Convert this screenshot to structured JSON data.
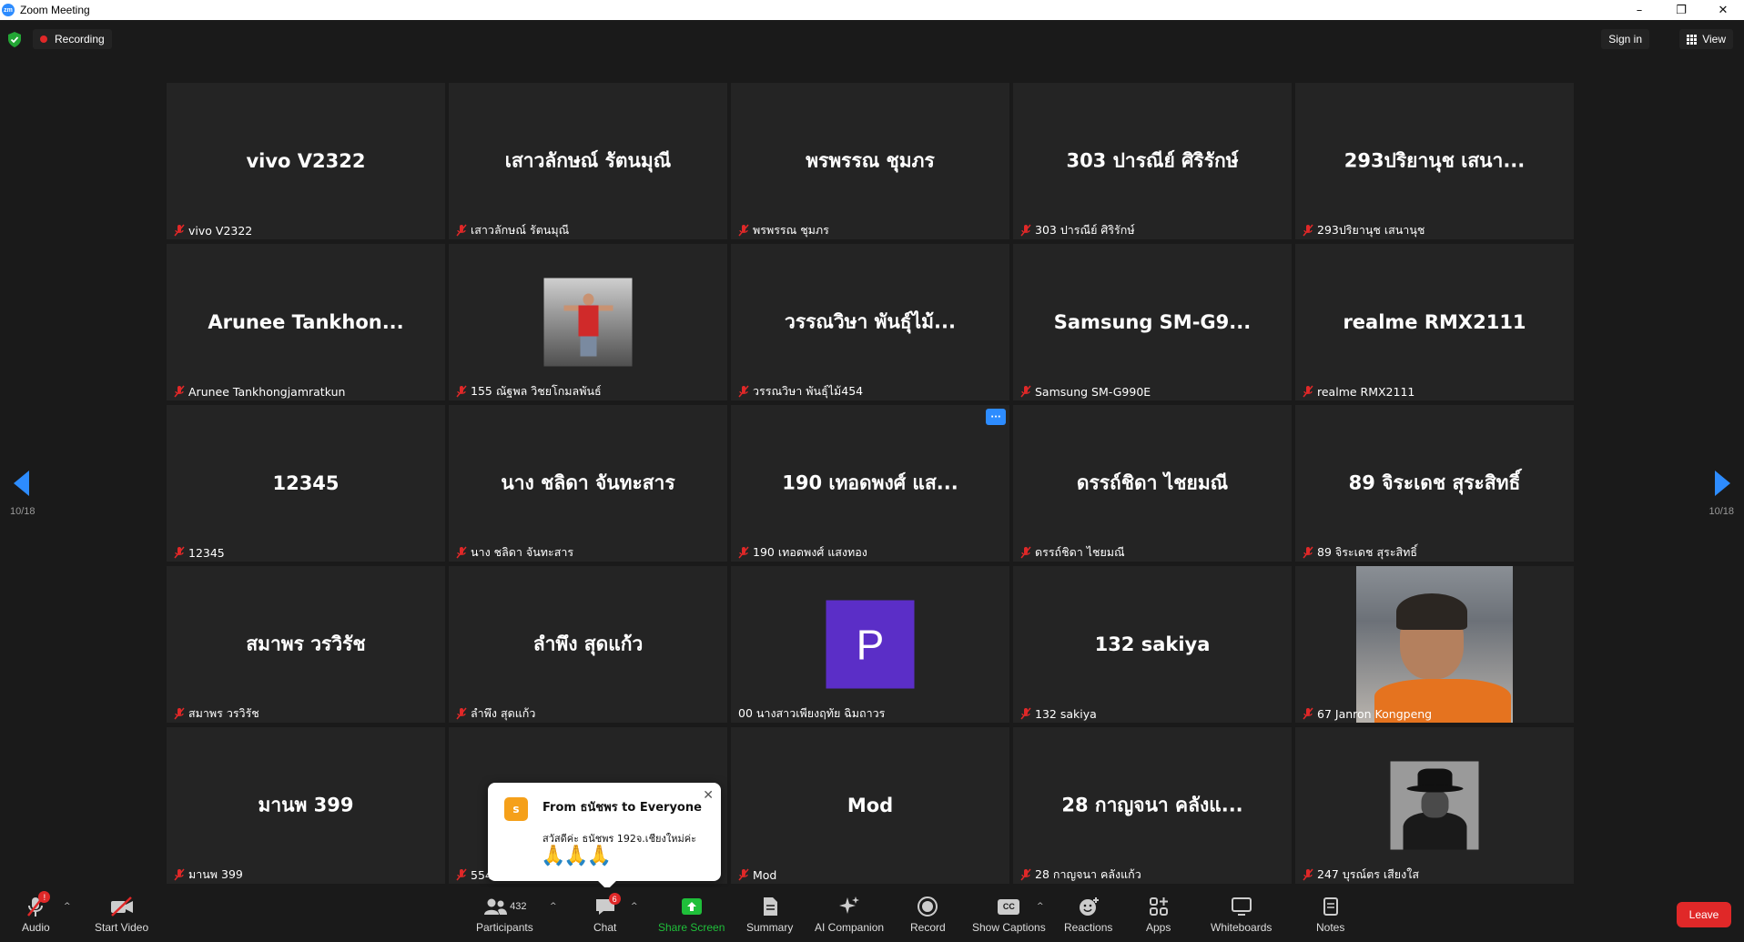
{
  "window": {
    "title": "Zoom Meeting",
    "logo_text": "zm",
    "minimize": "–",
    "restore": "❐",
    "close": "✕"
  },
  "topbar": {
    "recording_label": "Recording",
    "sign_in_label": "Sign in",
    "view_label": "View"
  },
  "pagination": {
    "left": "10/18",
    "right": "10/18"
  },
  "tiles": [
    {
      "big": "vivo V2322",
      "name": "vivo V2322"
    },
    {
      "big": "เสาวลักษณ์  รัตนมุณี",
      "name": "เสาวลักษณ์  รัตนมุณี"
    },
    {
      "big": "พรพรรณ ชุมภร",
      "name": "พรพรรณ ชุมภร"
    },
    {
      "big": "303 ปารณีย์ ศิริรักษ์",
      "name": "303 ปารณีย์ ศิริรักษ์"
    },
    {
      "big": "293ปริยานุช เสนา...",
      "name": "293ปริยานุช เสนานุช"
    },
    {
      "big": "Arunee  Tankhon...",
      "name": "Arunee Tankhongjamratkun"
    },
    {
      "big": "",
      "name": "155 ณัฐพล วิชยโกมลพันธ์"
    },
    {
      "big": "วรรณวิษา พันธุ์ไม้...",
      "name": "วรรณวิษา พันธุ์ไม้454"
    },
    {
      "big": "Samsung  SM-G9...",
      "name": "Samsung SM-G990E"
    },
    {
      "big": "realme RMX2111",
      "name": "realme RMX2111"
    },
    {
      "big": "12345",
      "name": "12345"
    },
    {
      "big": "นาง ชลิดา จันทะสาร",
      "name": "นาง ชลิดา จันทะสาร"
    },
    {
      "big": "190 เทอดพงศ์ แส...",
      "name": "190 เทอดพงศ์ แสงทอง",
      "more": "···"
    },
    {
      "big": "ดรรถ์ชิดา ไชยมณี",
      "name": "ดรรถ์ชิดา ไชยมณี"
    },
    {
      "big": "89 จิระเดช สุระสิทธิ์",
      "name": "89 จิระเดช สุระสิทธิ์"
    },
    {
      "big": "สมาพร  วรวิรัช",
      "name": "สมาพร  วรวิรัช"
    },
    {
      "big": "ลำพึง สุดแก้ว",
      "name": "ลำพึง สุดแก้ว"
    },
    {
      "big": "",
      "name": "00 นางสาวเพียงฤทัย ฉิมถาวร",
      "avatar_letter": "P"
    },
    {
      "big": "132 sakiya",
      "name": "132 sakiya"
    },
    {
      "big": "",
      "name": "67 Janron Kongpeng"
    },
    {
      "big": "มานพ 399",
      "name": "มานพ 399"
    },
    {
      "big": "",
      "name": "554"
    },
    {
      "big": "Mod",
      "name": "Mod"
    },
    {
      "big": "28 กาญจนา คลังแ...",
      "name": "28 กาญจนา คลังแก้ว"
    },
    {
      "big": "",
      "name": "247 บุรณ์ตร เสียงใส"
    }
  ],
  "chat_popup": {
    "avatar_letter": "s",
    "from": "From ธนัชพร to Everyone",
    "message": "สวัสดีค่ะ ธนัชพร 192จ.เชียงใหม่ค่ะ",
    "emoji": "🙏🙏🙏",
    "close": "✕"
  },
  "toolbar": {
    "audio": "Audio",
    "audio_badge": "!",
    "start_video": "Start Video",
    "participants": "Participants",
    "participants_count": "432",
    "chat": "Chat",
    "chat_badge": "6",
    "share_screen": "Share Screen",
    "summary": "Summary",
    "ai_companion": "AI Companion",
    "record": "Record",
    "show_captions": "Show Captions",
    "cc": "CC",
    "reactions": "Reactions",
    "apps": "Apps",
    "whiteboards": "Whiteboards",
    "notes": "Notes",
    "leave": "Leave",
    "caret": "^"
  },
  "colors": {
    "accent": "#2d8cff",
    "recording": "#e02828",
    "share": "#1fbf3a",
    "leave": "#e02828",
    "avatar_p": "#5b2ec7"
  }
}
